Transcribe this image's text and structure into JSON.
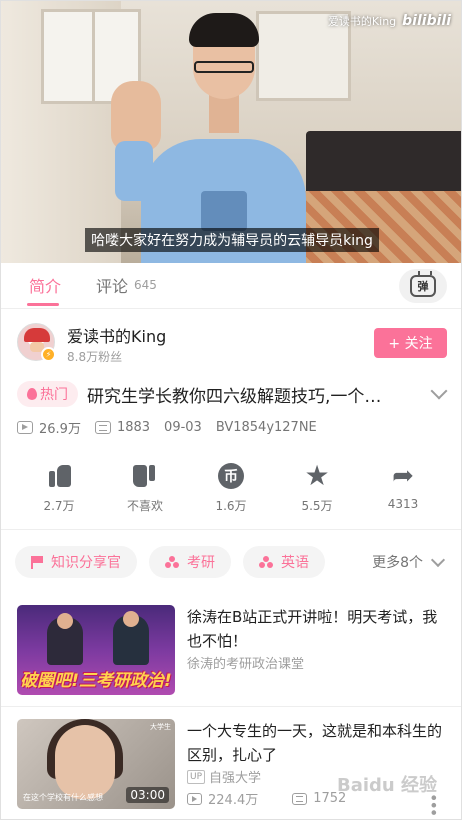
{
  "video": {
    "subtitle": "哈喽大家好在努力成为辅导员的云辅导员king",
    "watermark_author": "爱读书的King",
    "watermark_brand": "bilibili"
  },
  "tabs": {
    "intro_label": "简介",
    "comments_label": "评论",
    "comments_count": "645",
    "danmaku_button": "弹"
  },
  "uploader": {
    "name": "爱读书的King",
    "fans": "8.8万粉丝",
    "follow_label": "+ 关注"
  },
  "video_info": {
    "hot_label": "热门",
    "title": "研究生学长教你四六级解题技巧,一个…",
    "views": "26.9万",
    "danmaku": "1883",
    "date": "09-03",
    "bvid": "BV1854y127NE"
  },
  "actions": [
    {
      "label": "2.7万",
      "icon": "like-icon"
    },
    {
      "label": "不喜欢",
      "icon": "dislike-icon"
    },
    {
      "label": "1.6万",
      "icon": "coin-icon"
    },
    {
      "label": "5.5万",
      "icon": "favorite-icon"
    },
    {
      "label": "4313",
      "icon": "share-icon"
    }
  ],
  "coin_glyph": "币",
  "tags": [
    {
      "label": "知识分享官",
      "icon": "flag-icon"
    },
    {
      "label": "考研",
      "icon": "tag-dots-icon"
    },
    {
      "label": "英语",
      "icon": "tag-dots-icon"
    }
  ],
  "more_tags": "更多8个",
  "related": [
    {
      "title": "徐涛在B站正式开讲啦！明天考试，我也不怕！",
      "owner": "徐涛的考研政治课堂",
      "thumb_text": "破圈吧!三考研政治!"
    },
    {
      "title": "一个大专生的一天，这就是和本科生的区别，扎心了",
      "owner_badge": "UP",
      "owner": "自强大学",
      "duration": "03:00",
      "views": "224.4万",
      "danmaku": "1752",
      "thumb_caption": "在这个学校有什么感想",
      "thumb_top": "大学生"
    }
  ],
  "site_watermark": "Baidu 经验",
  "colors": {
    "accent": "#fb7299",
    "text": "#212121",
    "muted": "#9e9e9e"
  }
}
